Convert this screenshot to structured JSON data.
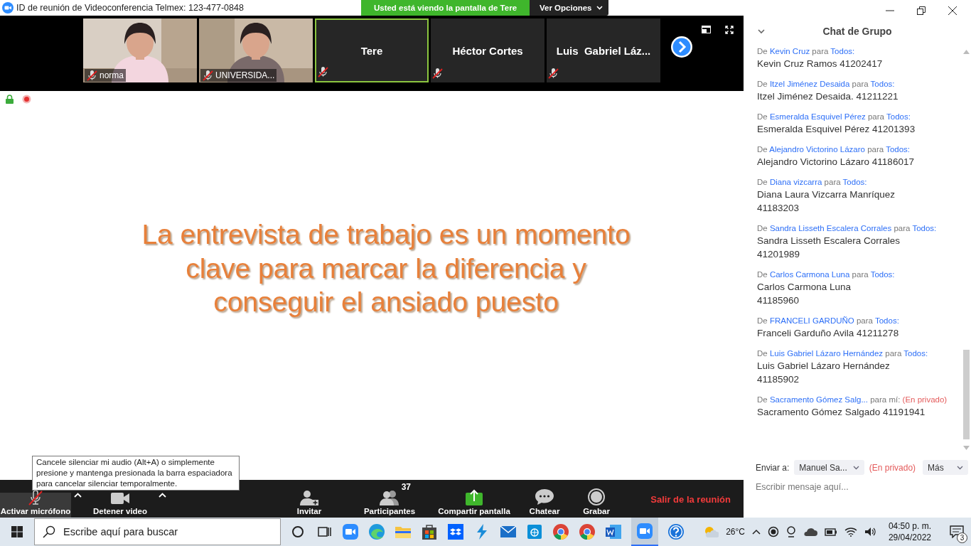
{
  "window": {
    "title": "ID de reunión de Videoconferencia Telmex: 123-477-0848"
  },
  "banner": {
    "text": "Usted está viendo la pantalla de Tere",
    "options_button": "Ver Opciones"
  },
  "video_tiles": [
    {
      "name": "norma",
      "kind": "video",
      "selected": false,
      "muted": true
    },
    {
      "name": "UNIVERSIDA...",
      "kind": "video",
      "selected": false,
      "muted": true
    },
    {
      "name": "Tere",
      "kind": "name",
      "selected": true,
      "muted": true
    },
    {
      "name": "Héctor Cortes",
      "kind": "name",
      "selected": false,
      "muted": true
    },
    {
      "name": "Luis  Gabriel Láz...",
      "kind": "name",
      "selected": false,
      "muted": true
    }
  ],
  "slide": {
    "text": "La entrevista de trabajo es un momento\nclave para marcar la diferencia y\nconseguir el ansiado puesto"
  },
  "tooltip": "Cancele silenciar mi audio (Alt+A) o simplemente presione y mantenga presionada la barra espaciadora para cancelar silenciar temporalmente.",
  "toolbar": [
    {
      "label": "Activar micrófono",
      "kind": "mic",
      "muted": true,
      "menu": true
    },
    {
      "label": "Detener video",
      "kind": "video",
      "menu": true
    },
    {
      "label": "Invitar",
      "kind": "invite"
    },
    {
      "label": "Participantes",
      "kind": "participants",
      "count": "37"
    },
    {
      "label": "Compartir pantalla",
      "kind": "share"
    },
    {
      "label": "Chatear",
      "kind": "chat"
    },
    {
      "label": "Grabar",
      "kind": "record"
    }
  ],
  "leave_button": "Salir de la reunión",
  "chat": {
    "title": "Chat de Grupo",
    "messages": [
      {
        "from": "De",
        "sender": "Kevin Cruz",
        "to_label": "para",
        "recipient": "Todos:",
        "text": "Kevin Cruz Ramos 41202417"
      },
      {
        "from": "De",
        "sender": "Itzel Jiménez Desaida",
        "to_label": "para",
        "recipient": "Todos:",
        "text": "Itzel Jiménez Desaida. 41211221"
      },
      {
        "from": "De",
        "sender": "Esmeralda Esquivel Pérez",
        "to_label": "para",
        "recipient": "Todos:",
        "text": "Esmeralda Esquivel Pérez 41201393"
      },
      {
        "from": "De",
        "sender": "Alejandro Victorino Lázaro",
        "to_label": "para",
        "recipient": "Todos:",
        "text": "Alejandro Victorino Lázaro 41186017"
      },
      {
        "from": "De",
        "sender": "Diana vizcarra",
        "to_label": "para",
        "recipient": "Todos:",
        "text": "Diana Laura Vizcarra Manríquez\n41183203"
      },
      {
        "from": "De",
        "sender": "Sandra Lisseth Escalera Corrales",
        "to_label": "para",
        "recipient": "Todos:",
        "text": "Sandra Lisseth Escalera Corrales\n41201989"
      },
      {
        "from": "De",
        "sender": "Carlos Carmona Luna",
        "to_label": "para",
        "recipient": "Todos:",
        "text": "Carlos Carmona Luna\n41185960"
      },
      {
        "from": "De",
        "sender": "FRANCELI GARDUÑO",
        "to_label": "para",
        "recipient": "Todos:",
        "text": "Franceli  Garduño Avila 41211278"
      },
      {
        "from": "De",
        "sender": "Luis Gabriel Lázaro Hernández",
        "to_label": "para",
        "recipient": "Todos:",
        "text": "Luis Gabriel Lázaro Hernández\n41185902"
      },
      {
        "from": "De",
        "sender": "Sacramento Gómez Salg...",
        "to_label": "para mí:",
        "privacy": "(En privado)",
        "text": "Sacramento Gómez Salgado 41191941"
      }
    ],
    "send_to": {
      "label": "Enviar a:",
      "recipient": "Manuel Sa...",
      "privacy": "(En privado)",
      "more": "Más"
    },
    "input": {
      "placeholder": "Escribir mensaje aquí..."
    }
  },
  "taskbar": {
    "search": {
      "placeholder": "Escribe aquí para buscar"
    },
    "temperature": "26°C",
    "time": "04:50 p. m.",
    "date": "29/04/2022",
    "notifications": "3"
  }
}
